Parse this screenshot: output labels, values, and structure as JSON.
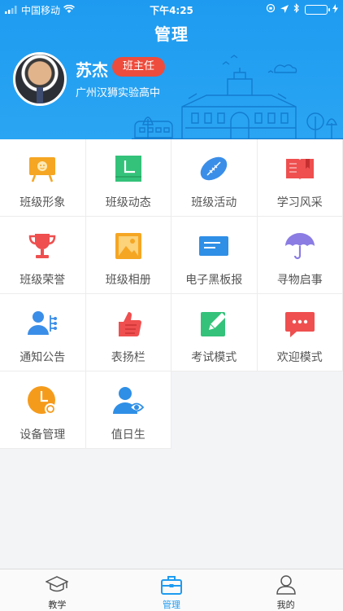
{
  "status_bar": {
    "carrier": "中国移动",
    "time": "下午4:25"
  },
  "header": {
    "title": "管理",
    "user_name": "苏杰",
    "role": "班主任",
    "school": "广州汉狮实验高中"
  },
  "menu": [
    {
      "label": "班级形象"
    },
    {
      "label": "班级动态"
    },
    {
      "label": "班级活动"
    },
    {
      "label": "学习风采"
    },
    {
      "label": "班级荣誉"
    },
    {
      "label": "班级相册"
    },
    {
      "label": "电子黑板报"
    },
    {
      "label": "寻物启事"
    },
    {
      "label": "通知公告"
    },
    {
      "label": "表扬栏"
    },
    {
      "label": "考试模式"
    },
    {
      "label": "欢迎模式"
    },
    {
      "label": "设备管理"
    },
    {
      "label": "值日生"
    }
  ],
  "tabs": [
    {
      "label": "教学",
      "active": false
    },
    {
      "label": "管理",
      "active": true
    },
    {
      "label": "我的",
      "active": false
    }
  ],
  "colors": {
    "primary": "#1e9bf0",
    "badge": "#ee4c3c"
  }
}
